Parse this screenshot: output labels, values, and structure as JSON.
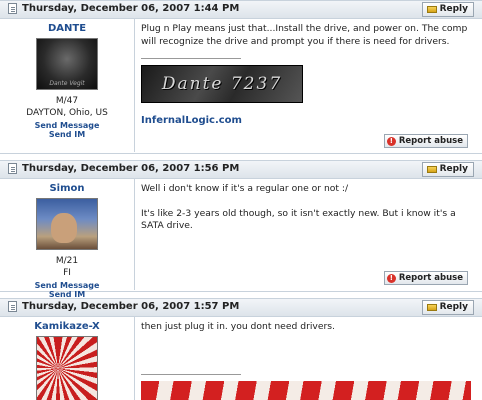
{
  "posts": [
    {
      "date": "Thursday, December 06, 2007 1:44 PM",
      "reply_label": "Reply",
      "username": "DANTE",
      "avatar_caption": "Dante Vegit",
      "info_line1": "M/47",
      "info_line2": "DAYTON, Ohio, US",
      "send_message": "Send Message",
      "send_im": "Send IM",
      "text": "Plug n Play means just that...Install the drive, and power on. The comp will recognize the drive and prompt you if there is need for drivers.",
      "signature_banner": "Dante 7237",
      "signature_link": "InfernalLogic.com",
      "report_label": "Report abuse"
    },
    {
      "date": "Thursday, December 06, 2007 1:56 PM",
      "reply_label": "Reply",
      "username": "Simon",
      "info_line1": "M/21",
      "info_line2": "FI",
      "send_message": "Send Message",
      "send_im": "Send IM",
      "text_line1": "Well i don't know if it's a regular one or not :/",
      "text_line2": "It's like 2-3 years old though, so it isn't exactly new. But i know it's a SATA drive.",
      "report_label": "Report abuse"
    },
    {
      "date": "Thursday, December 06, 2007 1:57 PM",
      "reply_label": "Reply",
      "username": "Kamikaze-X",
      "text": "then just plug it in. you dont need drivers."
    }
  ]
}
